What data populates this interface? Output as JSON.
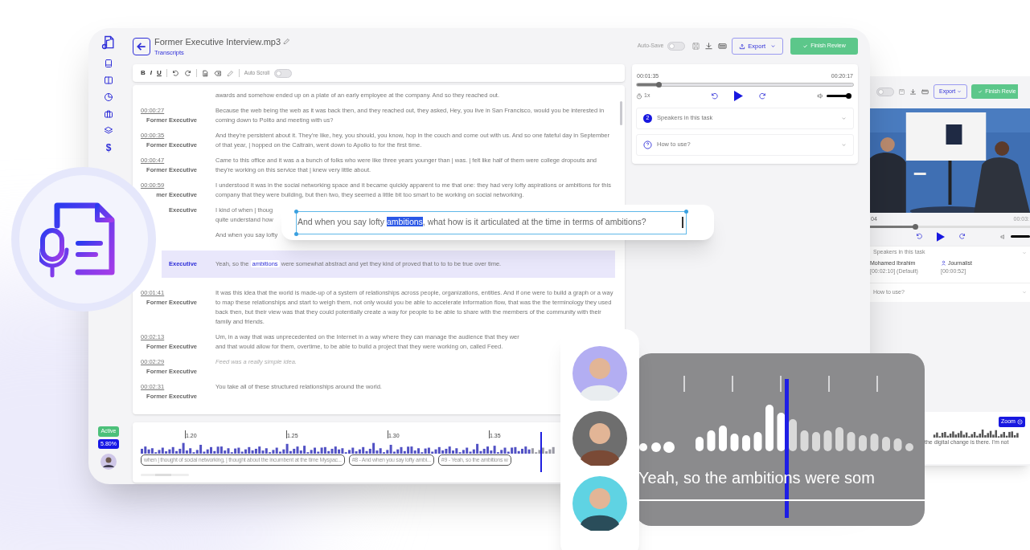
{
  "main": {
    "sidebar": {
      "status_badge": "Active",
      "usage_badge": "5.80%",
      "dollar": "$"
    },
    "header": {
      "title": "Former Executive Interview.mp3",
      "breadcrumb": "Transcripts",
      "auto_save": {
        "label": "Auto-Save",
        "on": false
      },
      "export_button": "Export",
      "finish_button": "Finish Review"
    },
    "toolbar": {
      "format_buttons": [
        "B",
        "I",
        "U"
      ],
      "auto_scroll": {
        "label": "Auto Scroll",
        "on": false
      }
    },
    "transcript": {
      "rows": [
        {
          "text": "awards and somehow ended up on a plate of an early employee at the company. And so they reached out.",
          "selected": false
        },
        {
          "time": "00:00:27",
          "speaker": "Former Executive",
          "text": "Because the web being the web as it was back then, and they reached out, they asked, Hey, you live in San Francisco, would you be interested in coming down to Polito and meeting with us?",
          "selected": false
        },
        {
          "time": "00:00:35",
          "speaker": "Former Executive",
          "text": "And they're persistent about it. They're like, hey, you should, you know, hop in the couch and come out with us. And so one fateful day in September of that year, | hopped on the Caltrain, went down to Apollo to for the first time.",
          "selected": false
        },
        {
          "time": "00:00:47",
          "speaker": "Former Executive",
          "text": "Came to this office and it was a a bunch of folks who were like three years younger than | was. | felt like half of them were college dropouts and they're working on this service that | knew very little about.",
          "selected": false
        },
        {
          "time": "00:00:59",
          "speaker": "mer Executive",
          "text": "I understood it was in the social networking space and it became quickly apparent to me that one: they had very lofty aspirations or ambitions for this company that they were building, but then two, they seemed a little bit too smart to be working on social networking.",
          "selected": false
        },
        {
          "speaker": "Executive",
          "lines": [
            "I kind of when | thoug",
            "quite understand how"
          ],
          "selected": false
        },
        {
          "lines": [
            "And when you say lofty"
          ],
          "selected": false
        },
        {
          "speaker": "Executive",
          "parts": {
            "before": "Yeah, so the ",
            "highlight": "ambitions",
            "after": " were somewhat abstract and yet they kind of proved that to to to be true over time."
          },
          "selected": true
        },
        {
          "time": "00:01:41",
          "speaker": "Former Executive",
          "text": "It was this idea that the world is made-up of a system of relationships across people, organizations, entities. And if one were to build a graph or a way to map these relationships and start to weigh them, not only would you be able to accelerate information flow, that was the the terminology they used back then, but their view was that they could potentially create a way for people to be able to share with the members of the community with their family and friends.",
          "selected": false
        },
        {
          "time": "00:02:13",
          "speaker": "Former Executive",
          "lines": [
            "Um, in a way that was unprecedented on the Internet in a way where they can manage the audience that they wer",
            "and that would allow for them, overtime, to be able to build a project that they were working on, called Feed."
          ],
          "selected": false
        },
        {
          "time": "00:02:29",
          "speaker": "Former Executive",
          "text": "Feed was a really simple idea.",
          "italic": true,
          "selected": false
        },
        {
          "time": "00:02:31",
          "speaker": "Former Executive",
          "text": "You take all of these structured relationships around the world.",
          "selected": false
        }
      ]
    },
    "timeline": {
      "ticks": [
        "1.20",
        "1.25",
        "1.30",
        "1.35"
      ],
      "segments": [
        "when | thought of social networking, | thought about the incumbent at the time Myspac...",
        "#8 - And when you say lofty ambi...",
        "#9 - Yeah, so the ambitions w"
      ]
    },
    "player": {
      "elapsed": "00:01:35",
      "duration": "00:20:17",
      "level": 0.1,
      "speed": "1x",
      "volume": {
        "level": 1
      },
      "sections": [
        {
          "kind": "count",
          "badge": "2",
          "title": "Speakers in this task"
        },
        {
          "kind": "help",
          "title": "How to use?"
        }
      ]
    }
  },
  "popup": {
    "before": "And when you say lofty ",
    "highlight": "ambitions",
    "after": ", what how is it articulated at the time in terms of ambitions?"
  },
  "back_window": {
    "auto_save": {
      "on": false
    },
    "progress": {
      "level": 0.28
    },
    "volume": {
      "level": 1
    },
    "export_button": "Export",
    "finish_button": "Finish Revie",
    "time_left": "04",
    "time_right": "00:03:",
    "speakers_title": "Speakers in this task",
    "speakers": [
      {
        "kind": "plain",
        "name": "Mohamed Ibrahim",
        "detail": "[00:02:10] (Default)"
      },
      {
        "kind": "icon",
        "name": "Journalist",
        "detail": "[00:00:52]"
      }
    ],
    "help_title": "How to use?",
    "zoom_button": "Zoom",
    "caption": "the digital change is there. I'm not"
  },
  "avatars": [
    {
      "color": "#b3aef2"
    },
    {
      "color": "#6e6e6e"
    },
    {
      "color": "#5fd3e3"
    }
  ],
  "wave_card": {
    "caption": "Yeah, so the ambitions were som"
  }
}
